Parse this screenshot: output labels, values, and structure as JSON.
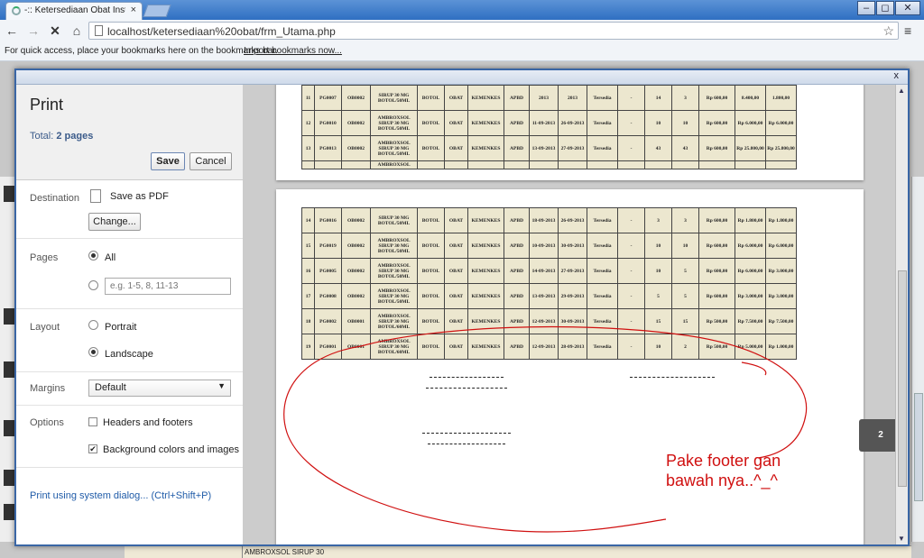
{
  "browser": {
    "tab_title": "-:: Ketersediaan Obat Instal",
    "tab_close": "×",
    "window_controls": {
      "minimize": "–",
      "maximize": "◻",
      "close": "✕"
    },
    "url": "localhost/ketersediaan%20obat/frm_Utama.php",
    "nav": {
      "back": "←",
      "forward": "→",
      "stop": "✕",
      "home": "⌂",
      "star": "☆",
      "menu": "≡"
    },
    "bookmarks_text": "For quick access, place your bookmarks here on the bookmarks bar.",
    "bookmarks_link": "Import bookmarks now..."
  },
  "print": {
    "dialog_close": "x",
    "title": "Print",
    "total_label": "Total:",
    "total_value": "2 pages",
    "save_label": "Save",
    "cancel_label": "Cancel",
    "destination_label": "Destination",
    "destination_value": "Save as PDF",
    "change_label": "Change...",
    "pages_label": "Pages",
    "pages_all": "All",
    "pages_range_placeholder": "e.g. 1-5, 8, 11-13",
    "layout_label": "Layout",
    "layout_portrait": "Portrait",
    "layout_landscape": "Landscape",
    "margins_label": "Margins",
    "margins_value": "Default",
    "options_label": "Options",
    "option_headers": "Headers and footers",
    "option_background": "Background colors and images",
    "system_dialog_link": "Print using system dialog... (Ctrl+Shift+P)",
    "page_badge": "2",
    "check_mark": "✔",
    "caret": "▼"
  },
  "preview_table_page1": [
    [
      "11",
      "PG0007",
      "OB0002",
      "SIRUP 30 MG BOTOL/50ML",
      "BOTOL",
      "OBAT",
      "KEMENKES",
      "APBD",
      "2013",
      "2013",
      "Tersedia",
      "-",
      "14",
      "3",
      "Rp 600,00",
      "8.400,00",
      "1.800,00"
    ],
    [
      "12",
      "PG0010",
      "OB0002",
      "AMBROXSOL SIRUP 30 MG BOTOL/50ML",
      "BOTOL",
      "OBAT",
      "KEMENKES",
      "APBD",
      "11-09-2013",
      "26-09-2013",
      "Tersedia",
      "-",
      "10",
      "10",
      "Rp 600,00",
      "Rp 6.000,00",
      "Rp 6.000,00"
    ],
    [
      "13",
      "PG0013",
      "OB0002",
      "AMBROXSOL SIRUP 30 MG BOTOL/50ML",
      "BOTOL",
      "OBAT",
      "KEMENKES",
      "APBD",
      "13-09-2013",
      "27-09-2013",
      "Tersedia",
      "-",
      "43",
      "43",
      "Rp 600,00",
      "Rp 25.800,00",
      "Rp 25.800,00"
    ],
    [
      "",
      "",
      "",
      "AMBROXSOL",
      "",
      "",
      "",
      "",
      "",
      "",
      "",
      "",
      "",
      "",
      "",
      "",
      ""
    ]
  ],
  "preview_table_page2": [
    [
      "14",
      "PG0016",
      "OB0002",
      "SIRUP 30 MG BOTOL/50ML",
      "BOTOL",
      "OBAT",
      "KEMENKES",
      "APBD",
      "18-09-2013",
      "26-09-2013",
      "Tersedia",
      "-",
      "3",
      "3",
      "Rp 600,00",
      "Rp 1.800,00",
      "Rp 1.800,00"
    ],
    [
      "15",
      "PG0019",
      "OB0002",
      "AMBROXSOL SIRUP 30 MG BOTOL/50ML",
      "BOTOL",
      "OBAT",
      "KEMENKES",
      "APBD",
      "10-09-2013",
      "30-09-2013",
      "Tersedia",
      "-",
      "10",
      "10",
      "Rp 600,00",
      "Rp 6.000,00",
      "Rp 6.000,00"
    ],
    [
      "16",
      "PG0005",
      "OB0002",
      "AMBROXSOL SIRUP 30 MG BOTOL/50ML",
      "BOTOL",
      "OBAT",
      "KEMENKES",
      "APBD",
      "14-09-2013",
      "27-09-2013",
      "Tersedia",
      "-",
      "10",
      "5",
      "Rp 600,00",
      "Rp 6.000,00",
      "Rp 3.000,00"
    ],
    [
      "17",
      "PG0008",
      "OB0002",
      "AMBROXSOL SIRUP 30 MG BOTOL/50ML",
      "BOTOL",
      "OBAT",
      "KEMENKES",
      "APBD",
      "13-09-2013",
      "29-09-2013",
      "Tersedia",
      "-",
      "5",
      "5",
      "Rp 600,00",
      "Rp 3.000,00",
      "Rp 3.000,00"
    ],
    [
      "18",
      "PG0002",
      "OB0001",
      "AMBROXSOL SIRUP 30 MG BOTOL/60ML",
      "BOTOL",
      "OBAT",
      "KEMENKES",
      "APBD",
      "12-09-2013",
      "30-09-2013",
      "Tersedia",
      "-",
      "15",
      "15",
      "Rp 500,00",
      "Rp 7.500,00",
      "Rp 7.500,00"
    ],
    [
      "19",
      "PG0001",
      "OB0001",
      "AMBROXSOL SIRUP 30 MG BOTOL/60ML",
      "BOTOL",
      "OBAT",
      "KEMENKES",
      "APBD",
      "12-09-2013",
      "28-09-2013",
      "Tersedia",
      "-",
      "10",
      "2",
      "Rp 500,00",
      "Rp 5.000,00",
      "Rp 1.000,00"
    ]
  ],
  "background_row": [
    "AMBROXSOL SIRUP 30"
  ],
  "annotation": {
    "line1": "Pake footer gan",
    "line2": "bawah nya..^_^",
    "color": "#d01010"
  }
}
